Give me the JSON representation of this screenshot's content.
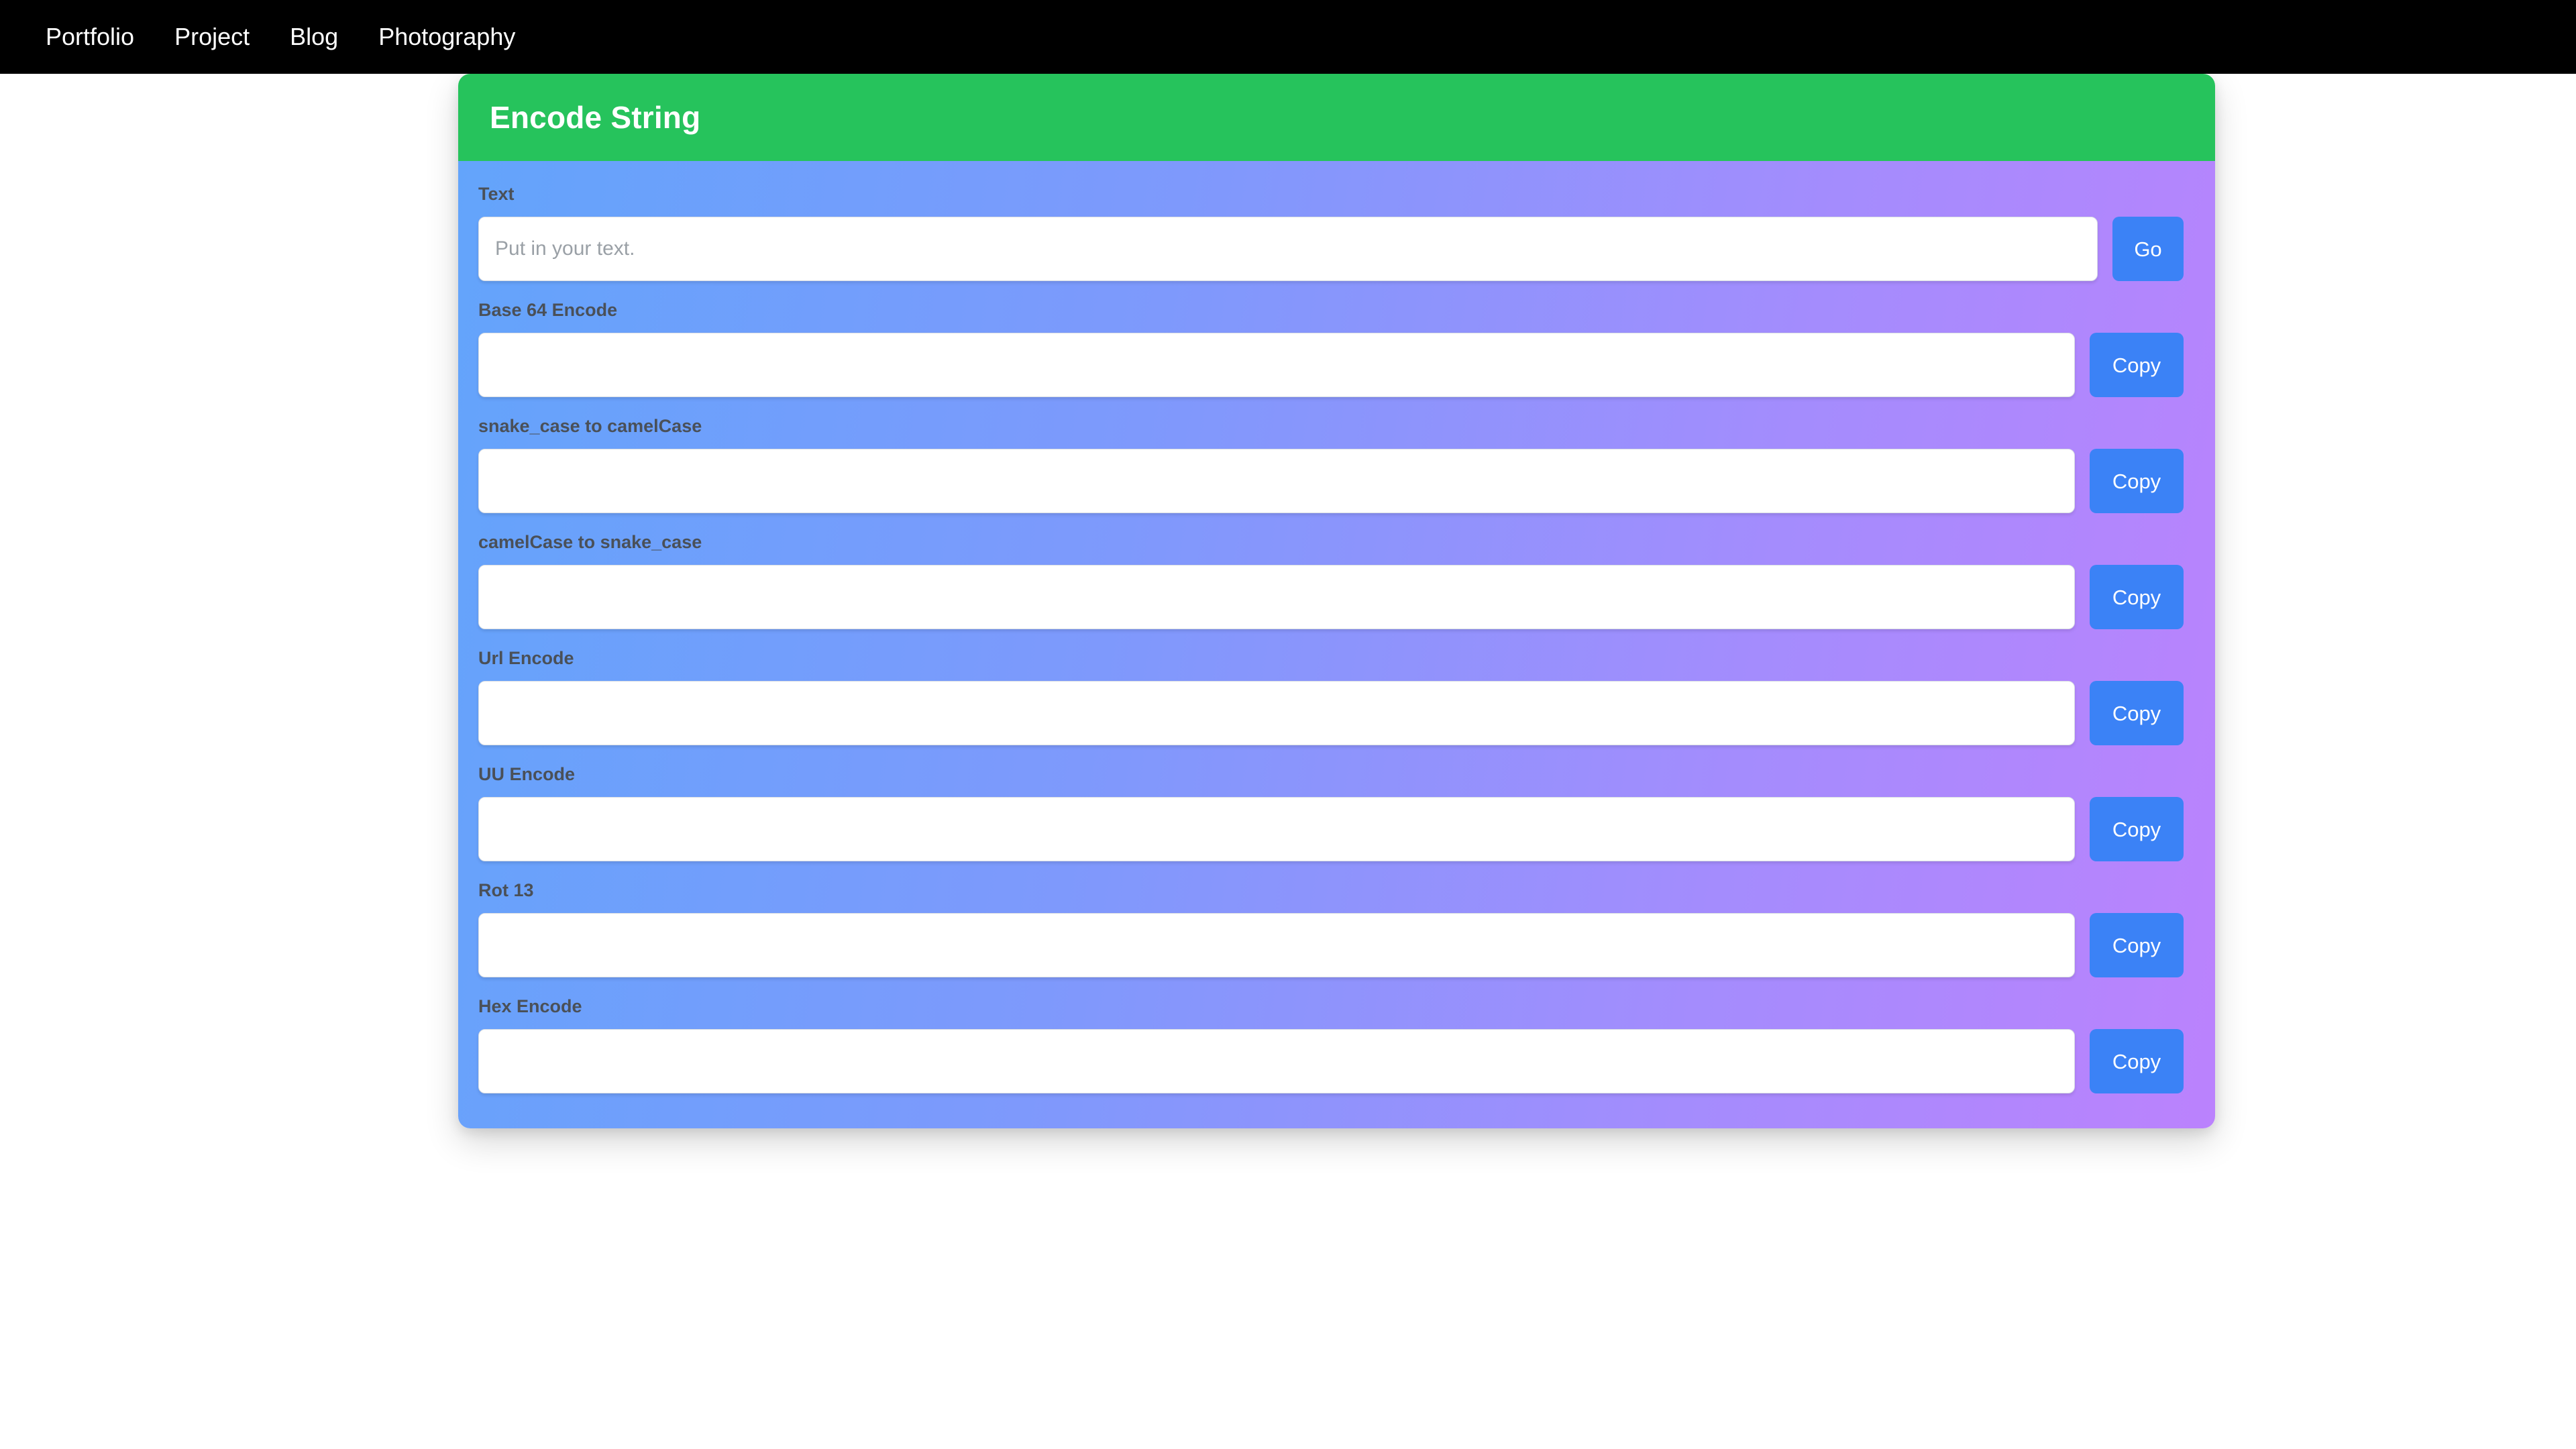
{
  "navbar": {
    "links": [
      {
        "label": "Portfolio"
      },
      {
        "label": "Project"
      },
      {
        "label": "Blog"
      },
      {
        "label": "Photography"
      }
    ]
  },
  "card": {
    "title": "Encode String",
    "header_color": "#26c35c",
    "gradient_start": "#63a4fb",
    "gradient_end": "#bb82fd",
    "button_color": "#3b82f6",
    "label_color": "#4a5058"
  },
  "fields": [
    {
      "label": "Text",
      "value": "",
      "placeholder": "Put in your text.",
      "button": "Go",
      "button_kind": "go"
    },
    {
      "label": "Base 64 Encode",
      "value": "",
      "placeholder": "",
      "button": "Copy",
      "button_kind": "copy"
    },
    {
      "label": "snake_case to camelCase",
      "value": "",
      "placeholder": "",
      "button": "Copy",
      "button_kind": "copy"
    },
    {
      "label": "camelCase to snake_case",
      "value": "",
      "placeholder": "",
      "button": "Copy",
      "button_kind": "copy"
    },
    {
      "label": "Url Encode",
      "value": "",
      "placeholder": "",
      "button": "Copy",
      "button_kind": "copy"
    },
    {
      "label": "UU Encode",
      "value": "",
      "placeholder": "",
      "button": "Copy",
      "button_kind": "copy"
    },
    {
      "label": "Rot 13",
      "value": "",
      "placeholder": "",
      "button": "Copy",
      "button_kind": "copy"
    },
    {
      "label": "Hex Encode",
      "value": "",
      "placeholder": "",
      "button": "Copy",
      "button_kind": "copy"
    }
  ]
}
